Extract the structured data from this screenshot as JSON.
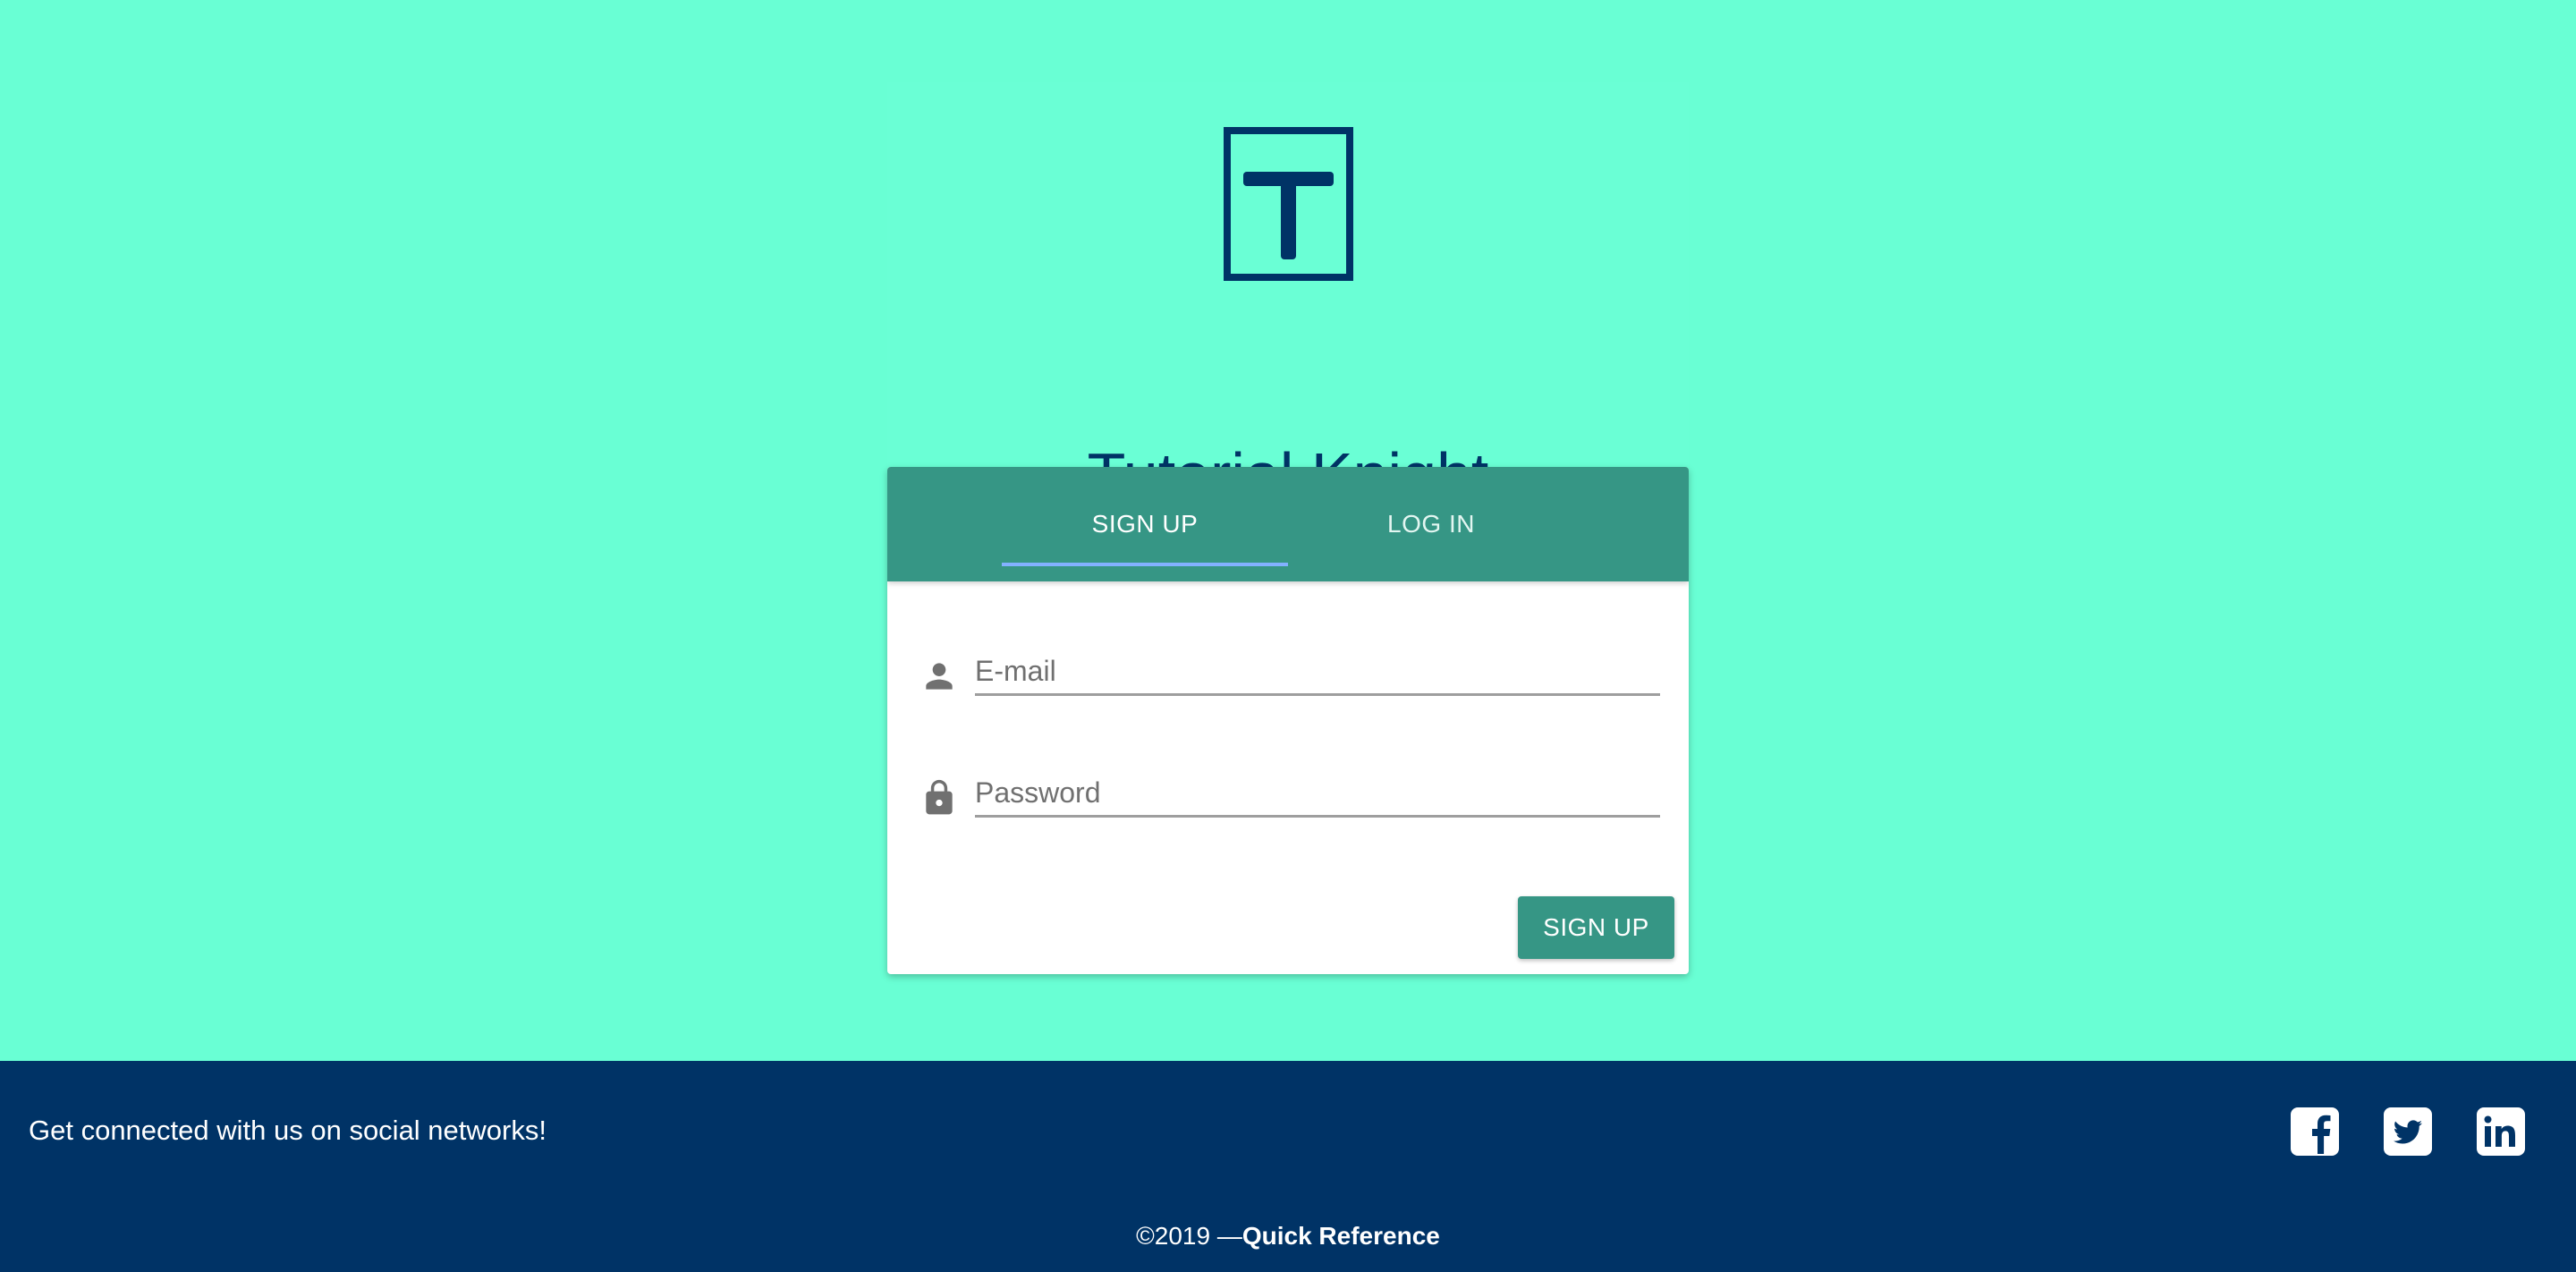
{
  "brand": {
    "title": "Tutorial Knight",
    "logo_icon": "t-logo-icon",
    "color": "#003366"
  },
  "tabs": [
    {
      "label": "SIGN UP",
      "active": true
    },
    {
      "label": "LOG IN",
      "active": false
    }
  ],
  "form": {
    "email": {
      "placeholder": "E-mail",
      "value": "",
      "icon": "person-icon"
    },
    "password": {
      "placeholder": "Password",
      "value": "",
      "icon": "lock-icon"
    },
    "submit_label": "SIGN UP"
  },
  "footer": {
    "tagline": "Get connected with us on social networks!",
    "social": [
      {
        "name": "facebook-icon"
      },
      {
        "name": "twitter-icon"
      },
      {
        "name": "linkedin-icon"
      }
    ],
    "copyright_prefix": "©2019 —",
    "copyright_link": "Quick Reference"
  },
  "colors": {
    "background": "#69ffd4",
    "primary": "#369685",
    "tab_indicator": "#82b1ff",
    "footer": "#003366"
  }
}
